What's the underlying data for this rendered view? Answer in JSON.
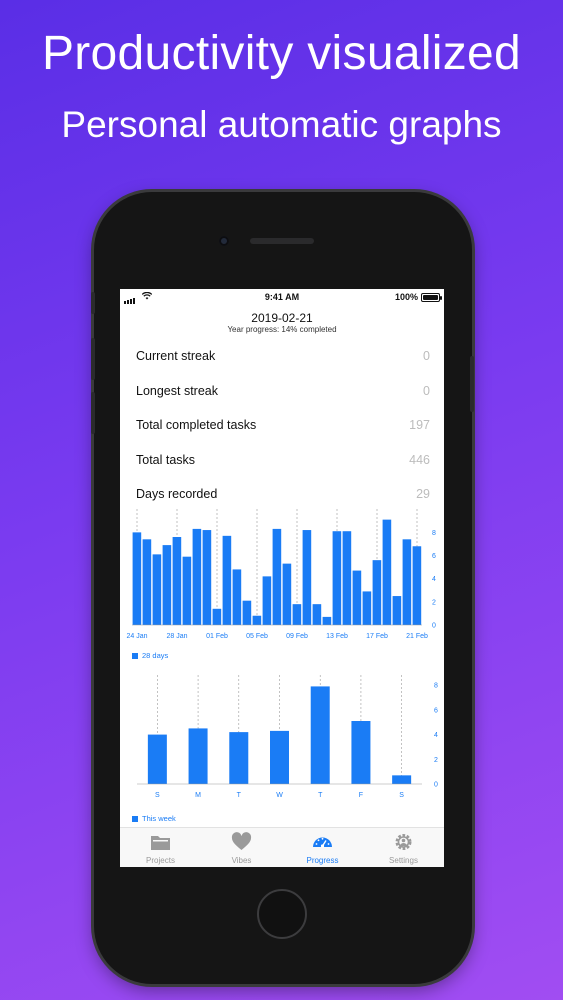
{
  "headline": {
    "title": "Productivity visualized",
    "subtitle": "Personal automatic graphs"
  },
  "status_bar": {
    "time": "9:41 AM",
    "battery": "100%"
  },
  "header": {
    "date": "2019-02-21",
    "year_progress": "Year progress: 14% completed"
  },
  "stats": [
    {
      "label": "Current streak",
      "value": "0"
    },
    {
      "label": "Longest streak",
      "value": "0"
    },
    {
      "label": "Total completed tasks",
      "value": "197"
    },
    {
      "label": "Total tasks",
      "value": "446"
    },
    {
      "label": "Days recorded",
      "value": "29"
    }
  ],
  "chart_data": [
    {
      "type": "bar",
      "title": "",
      "legend": "28 days",
      "legend_position": "bottom-left",
      "color": "#1a7cf5",
      "x_tick_labels": [
        "24 Jan",
        "28 Jan",
        "01 Feb",
        "05 Feb",
        "09 Feb",
        "13 Feb",
        "17 Feb",
        "21 Feb"
      ],
      "x": [
        "2019-01-24",
        "2019-01-25",
        "2019-01-26",
        "2019-01-27",
        "2019-01-28",
        "2019-01-29",
        "2019-01-30",
        "2019-01-31",
        "2019-02-01",
        "2019-02-02",
        "2019-02-03",
        "2019-02-04",
        "2019-02-05",
        "2019-02-06",
        "2019-02-07",
        "2019-02-08",
        "2019-02-09",
        "2019-02-10",
        "2019-02-11",
        "2019-02-12",
        "2019-02-13",
        "2019-02-14",
        "2019-02-15",
        "2019-02-16",
        "2019-02-17",
        "2019-02-18",
        "2019-02-19",
        "2019-02-20",
        "2019-02-21"
      ],
      "values": [
        8,
        7.4,
        6.1,
        6.9,
        7.6,
        5.9,
        8.3,
        8.2,
        1.4,
        7.7,
        4.8,
        2.1,
        0.8,
        4.2,
        8.3,
        5.3,
        1.8,
        8.2,
        1.8,
        0.7,
        8.1,
        8.1,
        4.7,
        2.9,
        5.6,
        9.1,
        2.5,
        7.4,
        6.8
      ],
      "y_ticks": [
        0,
        2,
        4,
        6,
        8
      ],
      "ylim": [
        0,
        9.5
      ],
      "y_axis_side": "right",
      "grid": "vertical dashed"
    },
    {
      "type": "bar",
      "title": "",
      "legend": "This week",
      "legend_position": "bottom-left",
      "color": "#1a7cf5",
      "categories": [
        "S",
        "M",
        "T",
        "W",
        "T",
        "F",
        "S"
      ],
      "values": [
        4,
        4.5,
        4.2,
        4.3,
        7.9,
        5.1,
        0.7
      ],
      "y_ticks": [
        0,
        2,
        4,
        6,
        8
      ],
      "ylim": [
        0,
        8.5
      ],
      "y_axis_side": "right",
      "grid": "vertical dashed"
    }
  ],
  "tabbar": {
    "tabs": [
      {
        "label": "Projects",
        "icon": "folder-icon",
        "active": false
      },
      {
        "label": "Vibes",
        "icon": "heart-icon",
        "active": false
      },
      {
        "label": "Progress",
        "icon": "gauge-icon",
        "active": true
      },
      {
        "label": "Settings",
        "icon": "gear-icon",
        "active": false
      }
    ]
  },
  "colors": {
    "accent": "#1a7cf5",
    "background_gradient_start": "#5a2ee6",
    "background_gradient_end": "#a14df2"
  }
}
